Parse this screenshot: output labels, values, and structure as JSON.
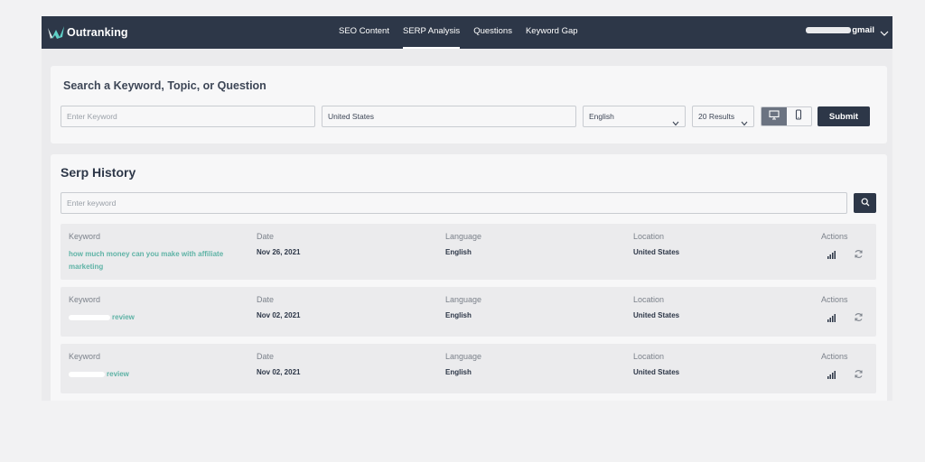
{
  "brand": {
    "name": "Outranking"
  },
  "nav": {
    "items": [
      {
        "label": "SEO Content",
        "active": false
      },
      {
        "label": "SERP Analysis",
        "active": true
      },
      {
        "label": "Questions",
        "active": false
      },
      {
        "label": "Keyword Gap",
        "active": false
      }
    ]
  },
  "account": {
    "label": "gmail"
  },
  "search": {
    "title": "Search a Keyword, Topic, or Question",
    "keyword_placeholder": "Enter Keyword",
    "location_value": "United States",
    "language_value": "English",
    "results_value": "20 Results",
    "device_selected": "desktop",
    "submit_label": "Submit"
  },
  "history": {
    "title": "Serp History",
    "search_placeholder": "Enter keyword",
    "columns": {
      "keyword": "Keyword",
      "date": "Date",
      "language": "Language",
      "location": "Location",
      "actions": "Actions"
    },
    "rows": [
      {
        "keyword": "how much money can you make with affiliate marketing",
        "date": "Nov 26, 2021",
        "language": "English",
        "location": "United States"
      },
      {
        "keyword": "review",
        "date": "Nov 02, 2021",
        "language": "English",
        "location": "United States"
      },
      {
        "keyword": "review",
        "date": "Nov 02, 2021",
        "language": "English",
        "location": "United States"
      }
    ]
  },
  "icons": {
    "logo": "outranking-logo-icon",
    "account_caret": "chevron-down-icon",
    "device_desktop": "desktop-icon",
    "device_mobile": "mobile-icon",
    "search": "search-icon",
    "action_stats": "signal-bars-icon",
    "action_refresh": "refresh-icon"
  },
  "colors": {
    "nav_bg": "#2d3748",
    "accent_link": "#5fb3a6",
    "button_bg": "#2d3748"
  }
}
